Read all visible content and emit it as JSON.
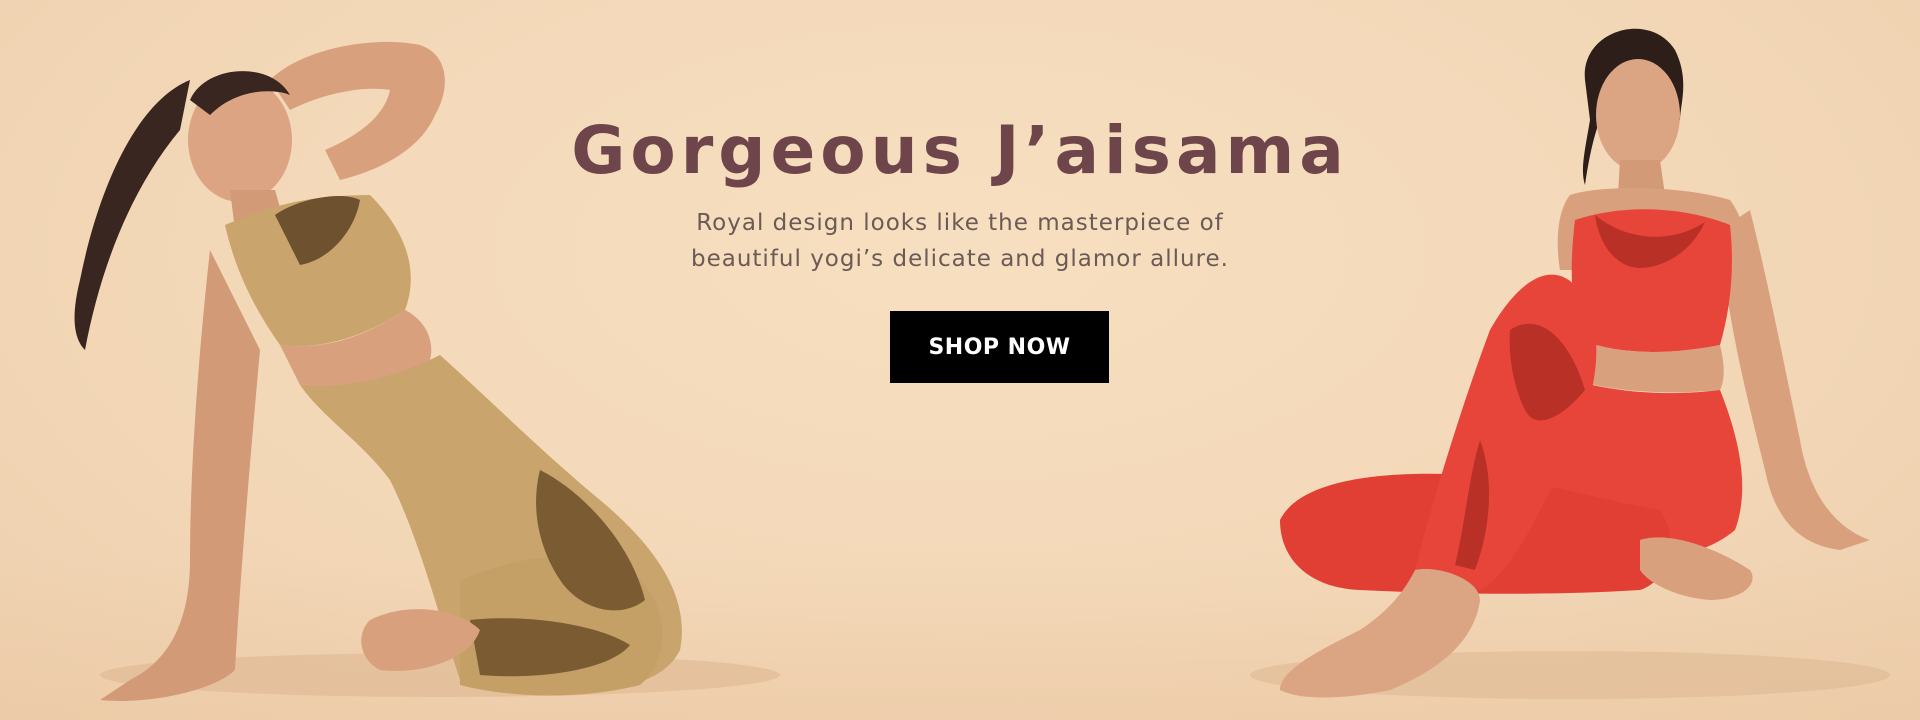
{
  "hero": {
    "headline": "Gorgeous J’aisama",
    "subtitle_line1": "Royal design looks like the masterpiece of",
    "subtitle_line2": "beautiful yogi’s delicate and glamor allure.",
    "cta_label": "SHOP NOW"
  },
  "colors": {
    "background": "#f3d9b9",
    "headline": "#6e454a",
    "subtitle": "#6b5a55",
    "cta_background": "#000000",
    "cta_text": "#ffffff",
    "left_outfit": "#c9a46c",
    "right_outfit": "#e8453a"
  },
  "imagery": {
    "left_model": "woman-in-tan-macrame-yoga-set",
    "right_model": "woman-in-red-macrame-yoga-set"
  }
}
